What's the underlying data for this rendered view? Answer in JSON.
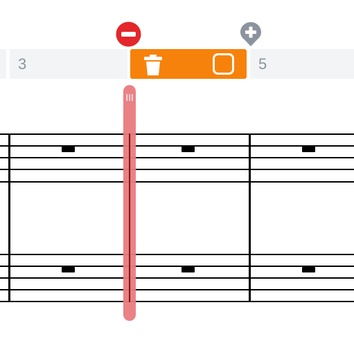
{
  "timeline": {
    "measure_3_label": "3",
    "measure_5_label": "5",
    "selected_color": "#f7820b"
  },
  "controls": {
    "remove_icon": "minus-circle-icon",
    "add_icon": "plus-pin-icon",
    "trash_icon": "trash-icon",
    "select_icon": "square-icon",
    "remove_color": "#e3272a",
    "add_color": "#8b949e"
  },
  "playhead": {
    "color": "#e97b7f",
    "line_color": "#8b1a1a"
  }
}
